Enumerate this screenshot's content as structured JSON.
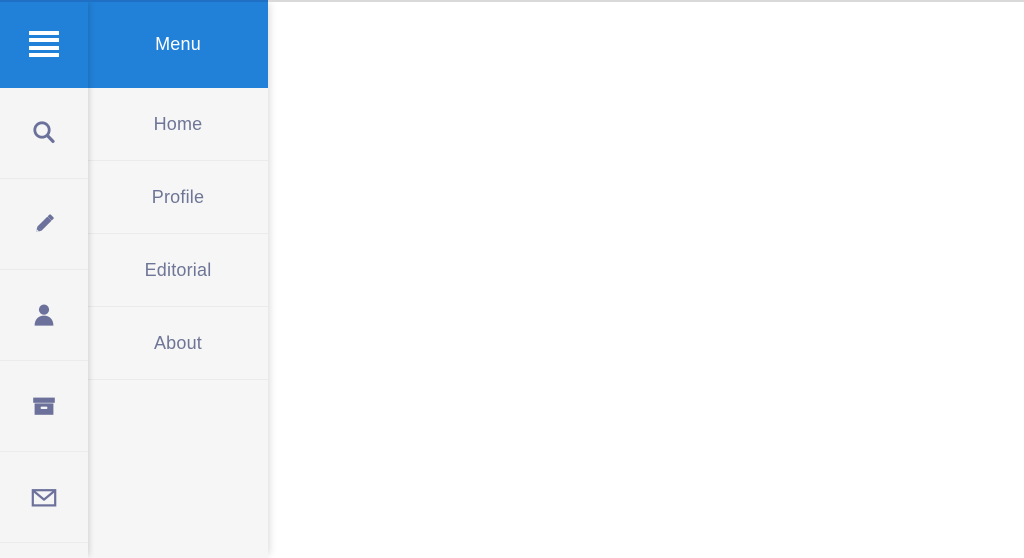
{
  "theme": {
    "accent": "#2180d8",
    "rail_bg": "#f5f5f5",
    "panel_bg": "#f6f6f6",
    "divider": "#ebebeb",
    "menu_text": "#6e7596",
    "icon_color": "#6b719b",
    "content_bg": "#ffffff",
    "header_text": "#ffffff"
  },
  "rail": {
    "toggle": {
      "name": "menu-toggle",
      "icon": "hamburger-icon",
      "bars": 4
    },
    "items": [
      {
        "icon": "search-icon",
        "label": "Search"
      },
      {
        "icon": "pencil-icon",
        "label": "Edit"
      },
      {
        "icon": "user-icon",
        "label": "Profile"
      },
      {
        "icon": "archive-icon",
        "label": "Archive"
      },
      {
        "icon": "envelope-icon",
        "label": "Mail"
      }
    ]
  },
  "menu": {
    "header": {
      "title": "Menu"
    },
    "items": [
      {
        "label": "Home",
        "active": false
      },
      {
        "label": "Profile",
        "active": false
      },
      {
        "label": "Editorial",
        "active": false
      },
      {
        "label": "About",
        "active": false
      }
    ]
  },
  "content": {
    "body_text": ""
  }
}
